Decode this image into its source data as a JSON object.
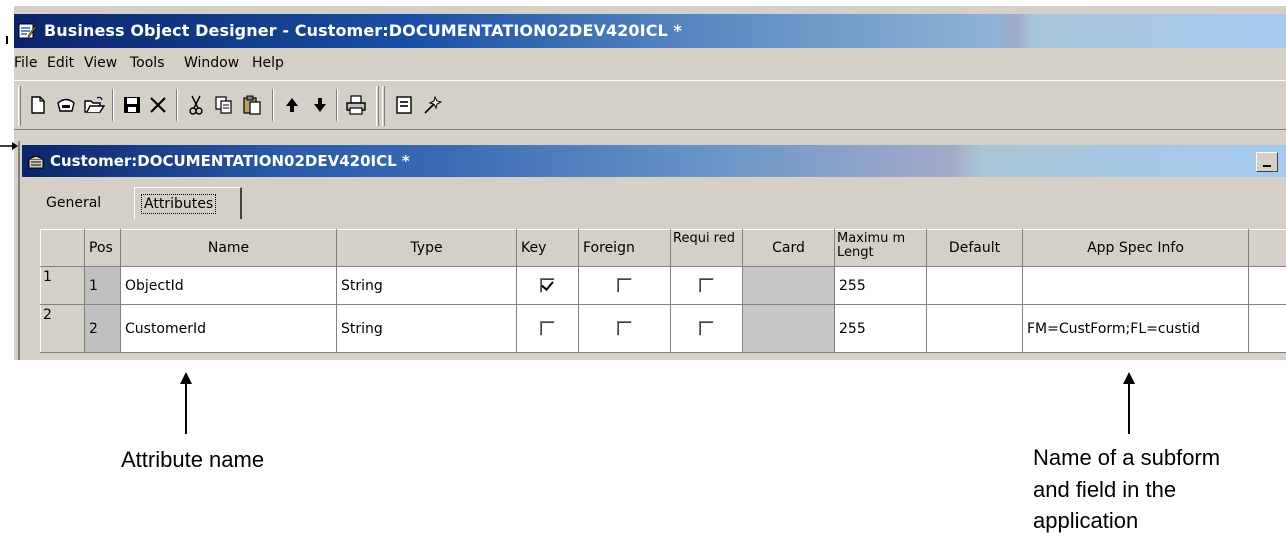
{
  "window": {
    "title": "Business Object Designer - Customer:DOCUMENTATION02DEV420ICL *"
  },
  "menu": {
    "items": [
      "File",
      "Edit",
      "View",
      "Tools",
      "Window",
      "Help"
    ]
  },
  "toolbar": {
    "buttons": [
      "new-icon",
      "open-server-icon",
      "open-folder-icon",
      "save-icon",
      "delete-icon",
      "cut-icon",
      "copy-icon",
      "paste-icon",
      "move-up-icon",
      "move-down-icon",
      "print-icon",
      "properties-icon",
      "wizard-icon"
    ]
  },
  "child": {
    "title": "Customer:DOCUMENTATION02DEV420ICL *",
    "tabs": [
      "General",
      "Attributes"
    ],
    "active_tab": "Attributes"
  },
  "grid": {
    "headers": [
      "Pos",
      "Name",
      "Type",
      "Key",
      "Foreign",
      "Requi red",
      "Card",
      "Maximu m Lengt",
      "Default",
      "App Spec Info"
    ],
    "rows": [
      {
        "row": "1",
        "pos": "1",
        "name": "ObjectId",
        "type": "String",
        "key": true,
        "foreign": false,
        "required": false,
        "card": "",
        "max_length": "255",
        "default": "",
        "app_spec_info": ""
      },
      {
        "row": "2",
        "pos": "2",
        "name": "CustomerId",
        "type": "String",
        "key": false,
        "foreign": false,
        "required": false,
        "card": "",
        "max_length": "255",
        "default": "",
        "app_spec_info": "FM=CustForm;FL=custid"
      }
    ]
  },
  "annotations": {
    "attribute_name": "Attribute name",
    "subform_line1": "Name of a subform",
    "subform_line2": "and field in the",
    "subform_line3": "application"
  }
}
